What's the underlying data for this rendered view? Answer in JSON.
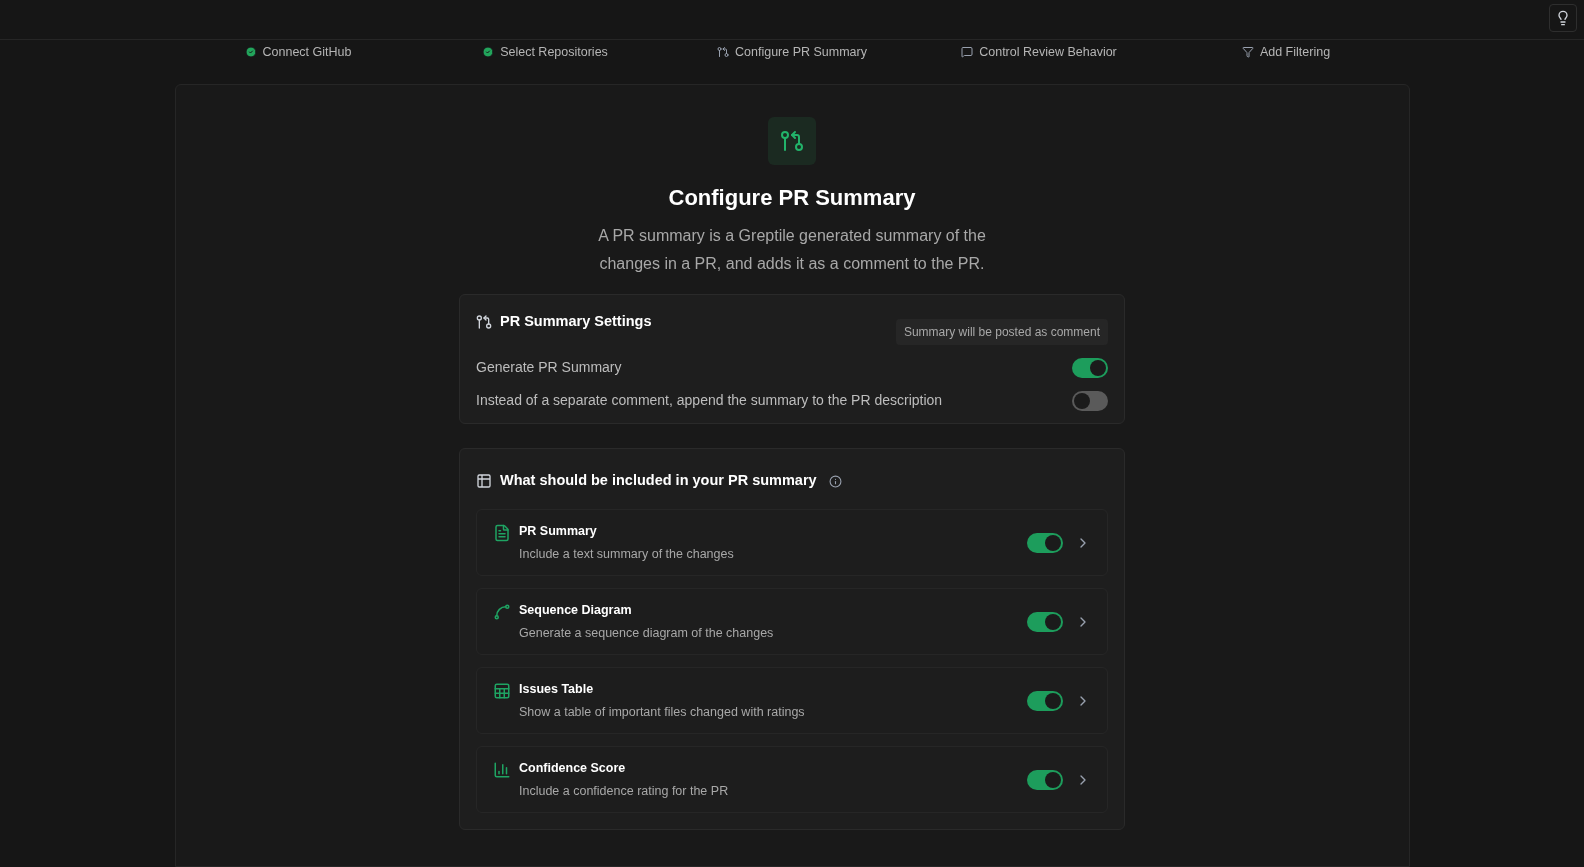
{
  "steps": [
    {
      "label": "Connect GitHub",
      "kind": "done"
    },
    {
      "label": "Select Repositories",
      "kind": "done"
    },
    {
      "label": "Configure PR Summary",
      "kind": "pull-request"
    },
    {
      "label": "Control Review Behavior",
      "kind": "comment"
    },
    {
      "label": "Add Filtering",
      "kind": "filter"
    }
  ],
  "header": {
    "title": "Configure PR Summary",
    "description": "A PR summary is a Greptile generated summary of the changes in a PR, and adds it as a comment to the PR."
  },
  "settings": {
    "title": "PR Summary Settings",
    "badge": "Summary will be posted as comment",
    "options": [
      {
        "label": "Generate PR Summary",
        "on": true
      },
      {
        "label": "Instead of a separate comment, append the summary to the PR description",
        "on": false
      }
    ]
  },
  "contents": {
    "title": "What should be included in your PR summary",
    "items": [
      {
        "kind": "document",
        "title": "PR Summary",
        "description": "Include a text summary of the changes",
        "on": true
      },
      {
        "kind": "diagram",
        "title": "Sequence Diagram",
        "description": "Generate a sequence diagram of the changes",
        "on": true
      },
      {
        "kind": "table",
        "title": "Issues Table",
        "description": "Show a table of important files changed with ratings",
        "on": true
      },
      {
        "kind": "chart",
        "title": "Confidence Score",
        "description": "Include a confidence rating for the PR",
        "on": true
      }
    ]
  }
}
